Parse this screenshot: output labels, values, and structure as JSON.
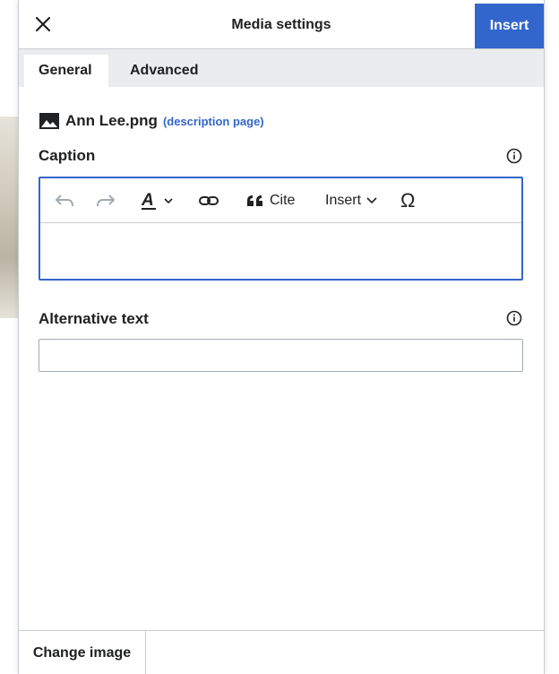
{
  "dialog": {
    "title": "Media settings",
    "close_icon": "close-icon",
    "insert_label": "Insert"
  },
  "tabs": [
    {
      "label": "General",
      "active": true
    },
    {
      "label": "Advanced",
      "active": false
    }
  ],
  "file": {
    "icon": "image-icon",
    "name": "Ann Lee.png",
    "description_link": "(description page)"
  },
  "caption": {
    "label": "Caption",
    "info_icon": "info-icon",
    "toolbar": {
      "undo_icon": "undo-icon",
      "redo_icon": "redo-icon",
      "text_style_icon": "text-style-icon",
      "link_icon": "link-icon",
      "cite_label": "Cite",
      "insert_label": "Insert",
      "special_char_icon": "omega-icon",
      "special_char_glyph": "Ω"
    },
    "value": ""
  },
  "alt_text": {
    "label": "Alternative text",
    "info_icon": "info-icon",
    "value": ""
  },
  "footer": {
    "change_image_label": "Change image"
  },
  "colors": {
    "accent": "#3366cc",
    "border": "#c8ccd1",
    "tab_bar": "#eaecf0",
    "text": "#202122"
  }
}
